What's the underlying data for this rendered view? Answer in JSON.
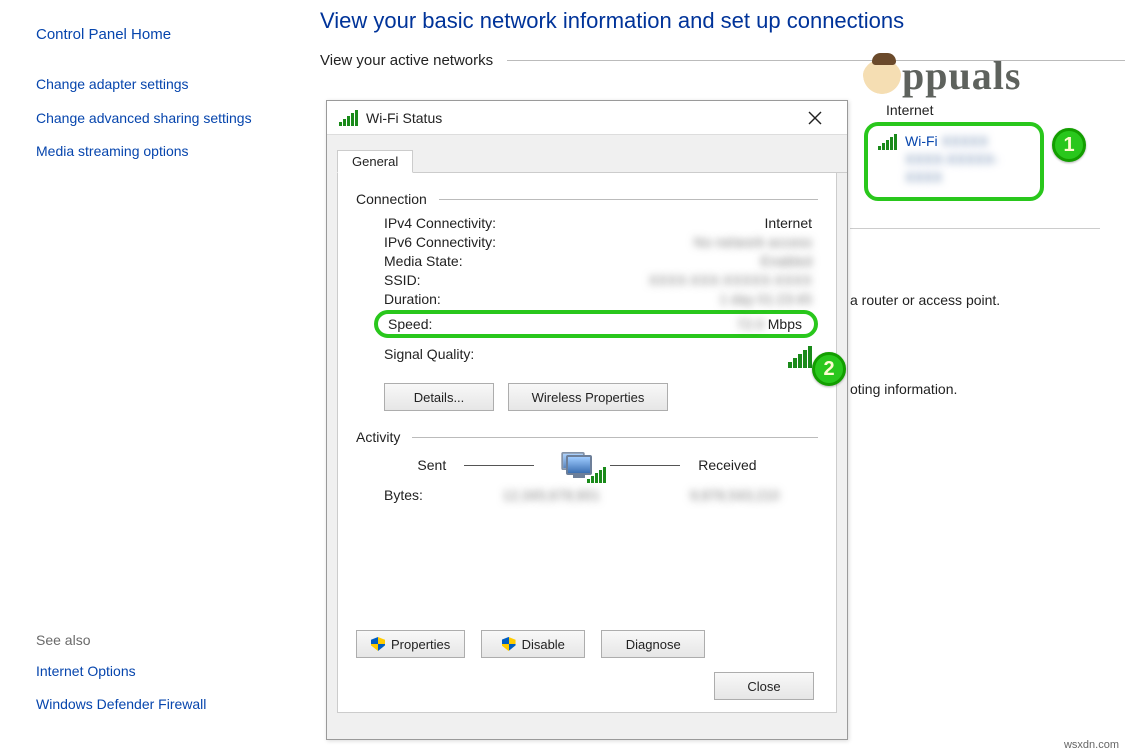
{
  "sidebar": {
    "home": "Control Panel Home",
    "links": [
      "Change adapter settings",
      "Change advanced sharing settings",
      "Media streaming options"
    ],
    "see_also_heading": "See also",
    "see_also": [
      "Internet Options",
      "Windows Defender Firewall"
    ]
  },
  "page": {
    "title": "View your basic network information and set up connections",
    "active_networks_label": "View your active networks",
    "hint1": "a router or access point.",
    "hint2": "oting information.",
    "hr_break": ""
  },
  "wifi_panel": {
    "access_label": "Internet",
    "link_label": "Wi-Fi",
    "link_extra": "XXXXX",
    "link_line2": "XXXX-XXXXX-XXXX"
  },
  "callouts": {
    "c1": "1",
    "c2": "2"
  },
  "dialog": {
    "title": "Wi-Fi Status",
    "tab": "General",
    "sections": {
      "connection": "Connection",
      "activity": "Activity"
    },
    "rows": {
      "ipv4_k": "IPv4 Connectivity:",
      "ipv4_v": "Internet",
      "ipv6_k": "IPv6 Connectivity:",
      "ipv6_v": "No network access",
      "media_k": "Media State:",
      "media_v": "Enabled",
      "ssid_k": "SSID:",
      "ssid_v": "XXXX-XXX-XXXXX-XXXX",
      "dur_k": "Duration:",
      "dur_v": "1 day 01:23:45",
      "speed_k": "Speed:",
      "speed_v_num": "72.0",
      "speed_v_unit": "Mbps",
      "sig_k": "Signal Quality:"
    },
    "buttons": {
      "details": "Details...",
      "wprops": "Wireless Properties",
      "properties": "Properties",
      "disable": "Disable",
      "diagnose": "Diagnose",
      "close": "Close"
    },
    "activity": {
      "sent": "Sent",
      "received": "Received",
      "bytes_label": "Bytes:",
      "bytes_sent": "12,345,678,901",
      "bytes_recv": "9,876,543,210"
    }
  },
  "watermark": "ppuals",
  "source_note": "wsxdn.com"
}
